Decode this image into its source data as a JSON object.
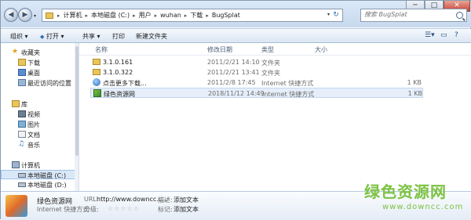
{
  "address": {
    "crumbs": [
      "计算机",
      "本地磁盘 (C:)",
      "用户",
      "wuhan",
      "下载",
      "BugSplat"
    ]
  },
  "search": {
    "placeholder": "搜索 BugSplat"
  },
  "toolbar": {
    "organize": "组织 ▾",
    "open": "打开 ▾",
    "share": "共享 ▾",
    "print": "打印",
    "new_folder": "新建文件夹"
  },
  "nav": {
    "favorites": "收藏夹",
    "downloads": "下载",
    "desktop": "桌面",
    "recent": "最近访问的位置",
    "library": "库",
    "video": "视频",
    "pictures": "图片",
    "documents": "文档",
    "music": "音乐",
    "computer": "计算机",
    "disk_c": "本地磁盘 (C:)",
    "disk_d": "本地磁盘 (D:)"
  },
  "columns": {
    "name": "名称",
    "modified": "修改日期",
    "type": "类型",
    "size": "大小"
  },
  "files": [
    {
      "name": "3.1.0.161",
      "date": "2011/2/21 14:10",
      "type": "文件夹",
      "size": "",
      "icon": "folder-icon"
    },
    {
      "name": "3.1.0.322",
      "date": "2011/2/21 13:41",
      "type": "文件夹",
      "size": "",
      "icon": "folder-icon"
    },
    {
      "name": "点击更多下载...",
      "date": "2011/2/8 17:45",
      "type": "Internet 快捷方式",
      "size": "1 KB",
      "icon": "internet-shortcut-icon"
    },
    {
      "name": "绿色资源网",
      "date": "2018/11/12 14:49",
      "type": "Internet 快捷方式",
      "size": "1 KB",
      "icon": "internet-shortcut-icon"
    }
  ],
  "details": {
    "title": "绿色资源网",
    "subtitle": "Internet 快捷方式",
    "url_label": "URL:",
    "url_value": "http://www.downcc.c...",
    "rating_label": "分级:",
    "stars": "☆☆☆☆☆",
    "desc_label": "描述:",
    "desc_value": "添加文本",
    "tag_label": "标记:",
    "tag_value": "添加文本"
  },
  "watermark": {
    "line1": "绿色资源网",
    "line2": "www.downcc.com"
  },
  "colors": {
    "selection": "#e5eef9",
    "accent": "#7cc243",
    "folder": "#e9c659"
  }
}
